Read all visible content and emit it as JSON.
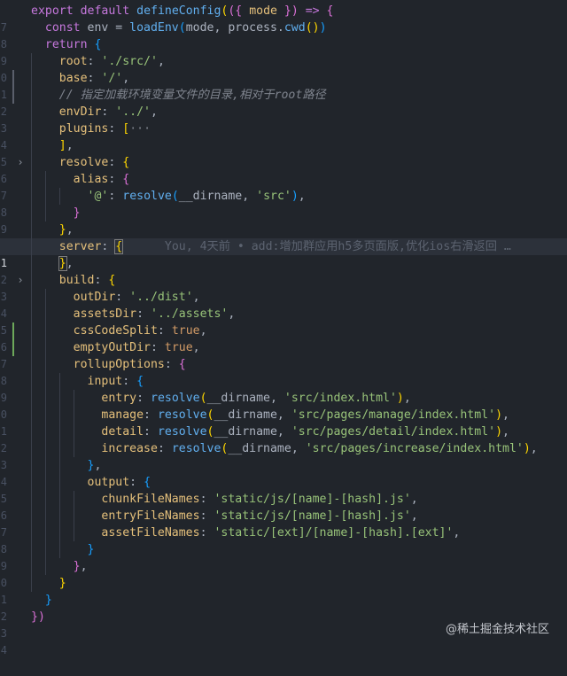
{
  "line_numbers": [
    "7",
    "8",
    "9",
    "0",
    "1",
    "2",
    "3",
    "4",
    "5",
    "6",
    "7",
    "8",
    "9",
    "0",
    "1",
    "2",
    "3",
    "4",
    "5",
    "6",
    "7",
    "8",
    "9",
    "0",
    "1",
    "2",
    "3",
    "4",
    "5",
    "6",
    "7",
    "8",
    "9",
    "0",
    "1",
    "2",
    "3",
    "4"
  ],
  "code": {
    "l7_export": "export",
    "l7_default": "default",
    "l7_fn": "defineConfig",
    "l7_p1": "(",
    "l7_p2": "({",
    "l7_param": " mode ",
    "l7_p3": "})",
    "l7_arrow": " => ",
    "l7_brace": "{",
    "l8_const": "const",
    "l8_env": " env = ",
    "l8_loadenv": "loadEnv",
    "l8_open": "(",
    "l8_mode": "mode, process.",
    "l8_cwd": "cwd",
    "l8_cwdp": "()",
    "l8_close": ")",
    "l9_return": "return",
    "l9_brace": "{",
    "l10_root": "root",
    "l10_colon": ": ",
    "l10_val": "'./src/'",
    "l10_comma": ",",
    "l11_base": "base",
    "l11_colon": ": ",
    "l11_val": "'/'",
    "l11_comma": ",",
    "l12_comment": "// 指定加载环境变量文件的目录,相对于root路径",
    "l13_envdir": "envDir",
    "l13_colon": ": ",
    "l13_val": "'../'",
    "l13_comma": ",",
    "l14_plugins": "plugins",
    "l14_colon": ": ",
    "l14_br": "[",
    "l14_ellipsis": "···",
    "l15_br": "]",
    "l15_comma": ",",
    "l16_resolve": "resolve",
    "l16_colon": ": ",
    "l16_brace": "{",
    "l17_alias": "alias",
    "l17_colon": ": ",
    "l17_brace": "{",
    "l18_key": "'@'",
    "l18_colon": ": ",
    "l18_fn": "resolve",
    "l18_open": "(",
    "l18_arg1": "__dirname, ",
    "l18_arg2": "'src'",
    "l18_close": ")",
    "l18_comma": ",",
    "l19_brace": "}",
    "l20_brace": "}",
    "l20_comma": ",",
    "l21_server": "server",
    "l21_colon": ": ",
    "l21_brace": "{",
    "l21_blame": "You, 4天前 • add:增加群应用h5多页面版,优化ios右滑返回 …",
    "l22_brace": "}",
    "l22_comma": ",",
    "l23_build": "build",
    "l23_colon": ": ",
    "l23_brace": "{",
    "l24_outdir": "outDir",
    "l24_colon": ": ",
    "l24_val": "'../dist'",
    "l24_comma": ",",
    "l25_assets": "assetsDir",
    "l25_colon": ": ",
    "l25_val": "'../assets'",
    "l25_comma": ",",
    "l26_css": "cssCodeSplit",
    "l26_colon": ": ",
    "l26_val": "true",
    "l26_comma": ",",
    "l27_empty": "emptyOutDir",
    "l27_colon": ": ",
    "l27_val": "true",
    "l27_comma": ",",
    "l28_rollup": "rollupOptions",
    "l28_colon": ": ",
    "l28_brace": "{",
    "l29_input": "input",
    "l29_colon": ": ",
    "l29_brace": "{",
    "l30_key": "entry",
    "l30_colon": ": ",
    "l30_fn": "resolve",
    "l30_open": "(",
    "l30_arg1": "__dirname, ",
    "l30_arg2": "'src/index.html'",
    "l30_close": ")",
    "l30_comma": ",",
    "l31_key": "manage",
    "l31_colon": ": ",
    "l31_fn": "resolve",
    "l31_open": "(",
    "l31_arg1": "__dirname, ",
    "l31_arg2": "'src/pages/manage/index.html'",
    "l31_close": ")",
    "l31_comma": ",",
    "l32_key": "detail",
    "l32_colon": ": ",
    "l32_fn": "resolve",
    "l32_open": "(",
    "l32_arg1": "__dirname, ",
    "l32_arg2": "'src/pages/detail/index.html'",
    "l32_close": ")",
    "l32_comma": ",",
    "l33_key": "increase",
    "l33_colon": ": ",
    "l33_fn": "resolve",
    "l33_open": "(",
    "l33_arg1": "__dirname, ",
    "l33_arg2": "'src/pages/increase/index.html'",
    "l33_close": ")",
    "l33_comma": ",",
    "l34_brace": "}",
    "l34_comma": ",",
    "l35_output": "output",
    "l35_colon": ": ",
    "l35_brace": "{",
    "l36_key": "chunkFileNames",
    "l36_colon": ": ",
    "l36_val": "'static/js/[name]-[hash].js'",
    "l36_comma": ",",
    "l37_key": "entryFileNames",
    "l37_colon": ": ",
    "l37_val": "'static/js/[name]-[hash].js'",
    "l37_comma": ",",
    "l38_key": "assetFileNames",
    "l38_colon": ": ",
    "l38_val": "'static/[ext]/[name]-[hash].[ext]'",
    "l38_comma": ",",
    "l39_brace": "}",
    "l40_brace": "}",
    "l40_comma": ",",
    "l41_brace": "}",
    "l42_brace": "}",
    "l43_close": "})"
  },
  "watermark": "@稀土掘金技术社区",
  "colors": {
    "background": "#21252b",
    "keyword": "#c678dd",
    "function": "#61afef",
    "string": "#98c379",
    "property": "#e5c07b",
    "boolean": "#d19a66",
    "comment": "#7f848e"
  }
}
